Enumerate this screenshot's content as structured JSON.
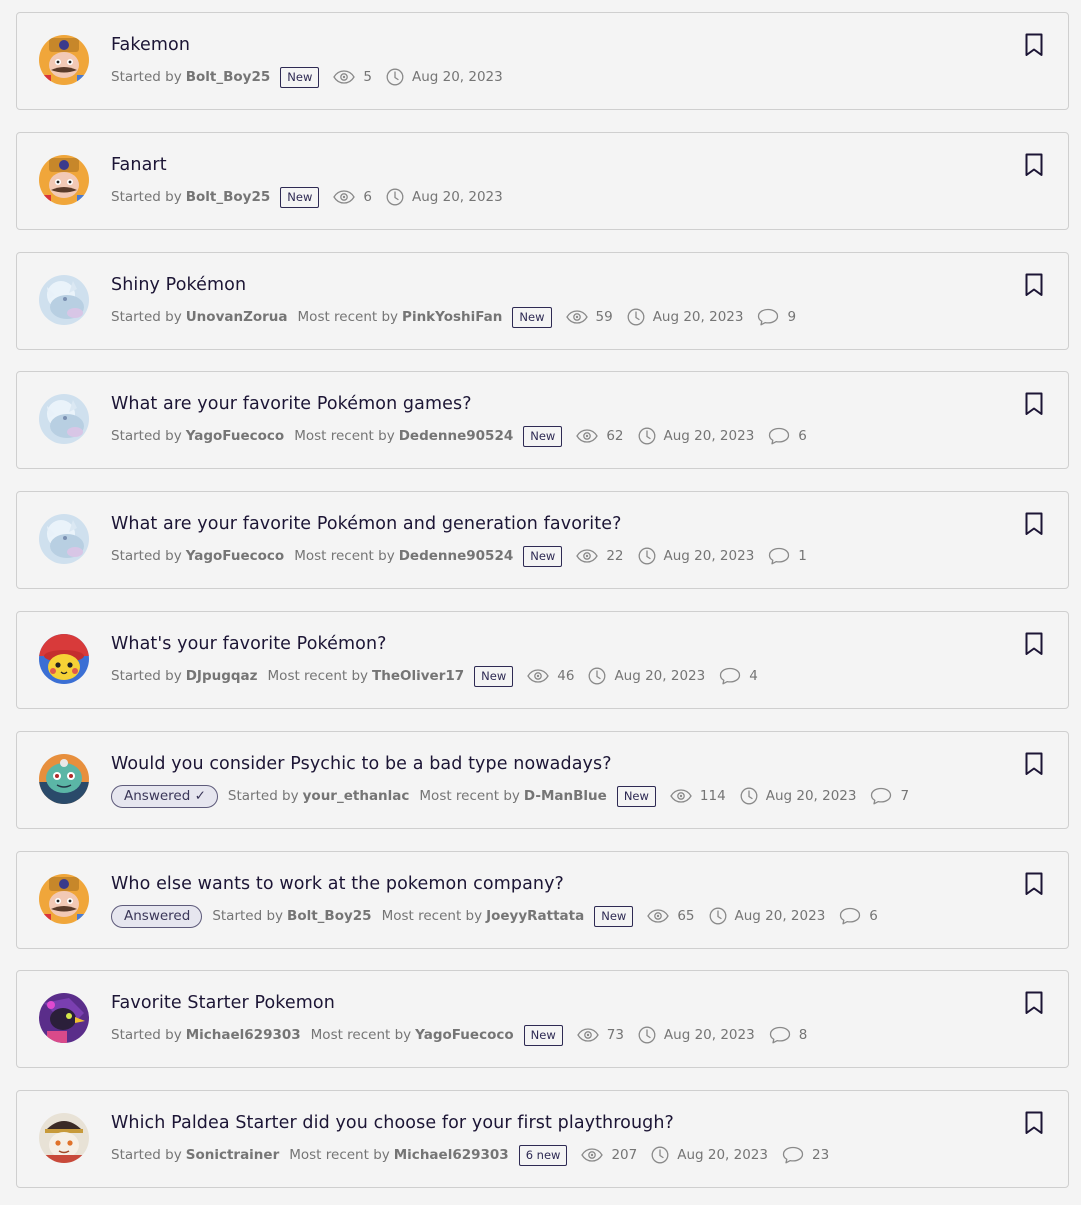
{
  "labels": {
    "started_by": "Started by",
    "most_recent_by": "Most recent by"
  },
  "icons": {
    "views": "eye-icon",
    "date": "clock-icon",
    "comments": "comment-bubble-icon",
    "bookmark": "bookmark-icon"
  },
  "colors": {
    "title": "#1c1535",
    "meta": "#757575",
    "badge_border": "#2e2a53",
    "card_border": "#cfcfcf",
    "background": "#f4f4f4"
  },
  "discussions": [
    {
      "title": "Fakemon",
      "answered": null,
      "started_by": "Bolt_Boy25",
      "most_recent_by": null,
      "badge": "New",
      "views": "5",
      "date": "Aug 20, 2023",
      "comments": null,
      "avatar": "mustache-man"
    },
    {
      "title": "Fanart",
      "answered": null,
      "started_by": "Bolt_Boy25",
      "most_recent_by": null,
      "badge": "New",
      "views": "6",
      "date": "Aug 20, 2023",
      "comments": null,
      "avatar": "mustache-man"
    },
    {
      "title": "Shiny Pokémon",
      "answered": null,
      "started_by": "UnovanZorua",
      "most_recent_by": "PinkYoshiFan",
      "badge": "New",
      "views": "59",
      "date": "Aug 20, 2023",
      "comments": "9",
      "avatar": "icy-creature"
    },
    {
      "title": "What are your favorite Pokémon games?",
      "answered": null,
      "started_by": "YagoFuecoco",
      "most_recent_by": "Dedenne90524",
      "badge": "New",
      "views": "62",
      "date": "Aug 20, 2023",
      "comments": "6",
      "avatar": "icy-creature"
    },
    {
      "title": "What are your favorite Pokémon and generation favorite?",
      "answered": null,
      "started_by": "YagoFuecoco",
      "most_recent_by": "Dedenne90524",
      "badge": "New",
      "views": "22",
      "date": "Aug 20, 2023",
      "comments": "1",
      "avatar": "icy-creature"
    },
    {
      "title": "What's your favorite Pokémon?",
      "answered": null,
      "started_by": "DJpugqaz",
      "most_recent_by": "TheOliver17",
      "badge": "New",
      "views": "46",
      "date": "Aug 20, 2023",
      "comments": "4",
      "avatar": "pikachu-cap"
    },
    {
      "title": "Would you consider Psychic to be a bad type nowadays?",
      "answered": "Answered ✓",
      "started_by": "your_ethanlac",
      "most_recent_by": "D-ManBlue",
      "badge": "New",
      "views": "114",
      "date": "Aug 20, 2023",
      "comments": "7",
      "avatar": "teal-creature"
    },
    {
      "title": "Who else wants to work at the pokemon company?",
      "answered": "Answered",
      "started_by": "Bolt_Boy25",
      "most_recent_by": "JoeyyRattata",
      "badge": "New",
      "views": "65",
      "date": "Aug 20, 2023",
      "comments": "6",
      "avatar": "mustache-man"
    },
    {
      "title": "Favorite Starter Pokemon",
      "answered": null,
      "started_by": "Michael629303",
      "most_recent_by": "YagoFuecoco",
      "badge": "New",
      "views": "73",
      "date": "Aug 20, 2023",
      "comments": "8",
      "avatar": "purple-bird"
    },
    {
      "title": "Which Paldea Starter did you choose for your first playthrough?",
      "answered": null,
      "started_by": "Sonictrainer",
      "most_recent_by": "Michael629303",
      "badge": "6 new",
      "views": "207",
      "date": "Aug 20, 2023",
      "comments": "23",
      "avatar": "pirate-cat"
    }
  ]
}
